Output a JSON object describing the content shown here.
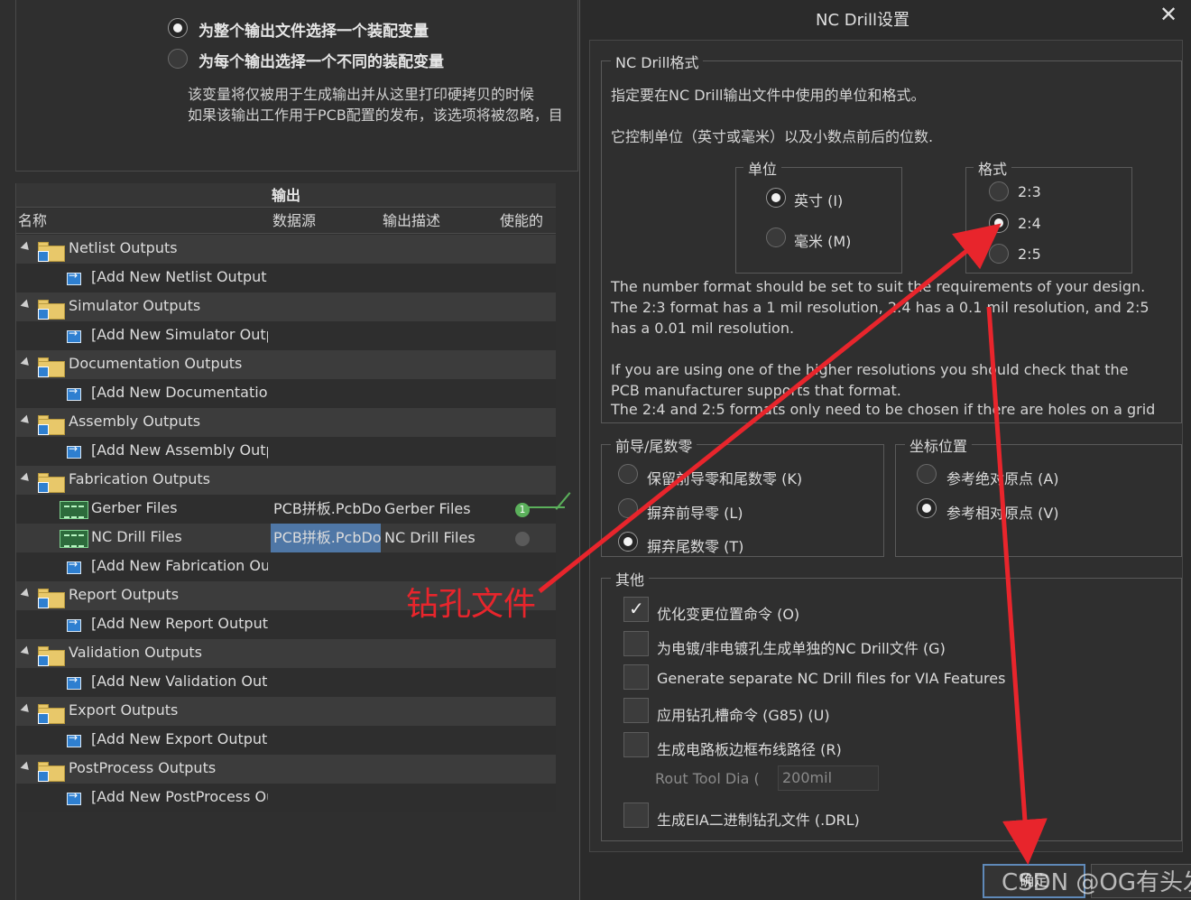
{
  "variant": {
    "option1": "为整个输出文件选择一个装配变量",
    "option2": "为每个输出选择一个不同的装配变量",
    "note1": "该变量将仅被用于生成输出并从这里打印硬拷贝的时候",
    "note2": "如果该输出工作用于PCB配置的发布，该选项将被忽略，目"
  },
  "outputs": {
    "title": "输出",
    "columns": [
      "名称",
      "数据源",
      "输出描述",
      "使能的"
    ],
    "rows": [
      {
        "type": "category",
        "label": "Netlist Outputs"
      },
      {
        "type": "add",
        "label": "[Add New Netlist Output]"
      },
      {
        "type": "category",
        "label": "Simulator Outputs"
      },
      {
        "type": "add",
        "label": "[Add New Simulator Outp"
      },
      {
        "type": "category",
        "label": "Documentation Outputs"
      },
      {
        "type": "add",
        "label": "[Add New Documentation"
      },
      {
        "type": "category",
        "label": "Assembly Outputs"
      },
      {
        "type": "add",
        "label": "[Add New Assembly Outpu"
      },
      {
        "type": "category",
        "label": "Fabrication Outputs"
      },
      {
        "type": "item",
        "label": "Gerber Files",
        "source": "PCB拼板.PcbDo",
        "description": "Gerber Files",
        "enabled_badge": "1",
        "enabled": true
      },
      {
        "type": "item",
        "label": "NC Drill Files",
        "source": "PCB拼板.PcbDo",
        "description": "NC Drill Files",
        "enabled": false,
        "selected": true
      },
      {
        "type": "add",
        "label": "[Add New Fabrication Out"
      },
      {
        "type": "category",
        "label": "Report Outputs"
      },
      {
        "type": "add",
        "label": "[Add New Report Output]"
      },
      {
        "type": "category",
        "label": "Validation Outputs"
      },
      {
        "type": "add",
        "label": "[Add New Validation Outp"
      },
      {
        "type": "category",
        "label": "Export Outputs"
      },
      {
        "type": "add",
        "label": "[Add New Export Output]"
      },
      {
        "type": "category",
        "label": "PostProcess Outputs"
      },
      {
        "type": "add",
        "label": "[Add New PostProcess Ou"
      }
    ]
  },
  "dialog": {
    "title": "NC Drill设置",
    "close": "✕",
    "format_group": {
      "label": "NC Drill格式",
      "desc1": "指定要在NC Drill输出文件中使用的单位和格式。",
      "desc2": "它控制单位（英寸或毫米）以及小数点前后的位数.",
      "units": {
        "label": "单位",
        "inch": "英寸 (I)",
        "mm": "毫米 (M)",
        "selected": "inch"
      },
      "format": {
        "label": "格式",
        "f23": "2:3",
        "f24": "2:4",
        "f25": "2:5",
        "selected": "2:4"
      },
      "info1": "The number format should be set to suit the requirements of your design. The 2:3 format has a 1 mil resolution, 2:4 has a 0.1 mil resolution, and 2:5 has a 0.01 mil resolution.",
      "info2": "If you are using one of the higher resolutions you should check that the PCB manufacturer supports that format.",
      "info3": "The 2:4 and 2:5 formats only need to be chosen if there are holes on a grid"
    },
    "zeros_group": {
      "label": "前导/尾数零",
      "keep": "保留前导零和尾数零 (K)",
      "suppress_leading": "摒弃前导零 (L)",
      "suppress_trailing": "摒弃尾数零 (T)",
      "selected": "suppress_trailing"
    },
    "coord_group": {
      "label": "坐标位置",
      "absolute": "参考绝对原点 (A)",
      "relative": "参考相对原点 (V)",
      "selected": "relative"
    },
    "other_group": {
      "label": "其他",
      "opt1": {
        "label": "优化变更位置命令 (O)",
        "checked": true
      },
      "opt2": {
        "label": "为电镀/非电镀孔生成单独的NC Drill文件 (G)",
        "checked": false
      },
      "opt3": {
        "label": "Generate separate NC Drill files for VIA Features",
        "checked": false
      },
      "opt4": {
        "label": "应用钻孔槽命令 (G85) (U)",
        "checked": false
      },
      "opt5": {
        "label": "生成电路板边框布线路径 (R)",
        "checked": false
      },
      "rout_label": "Rout Tool  Dia (",
      "rout_value": "200mil",
      "opt6": {
        "label": "生成EIA二进制钻孔文件 (.DRL)",
        "checked": false
      }
    },
    "ok_label": "确定"
  },
  "annotation": {
    "text": "钻孔文件",
    "color": "#e8252c"
  },
  "watermark": "CSDN @OG有头发"
}
